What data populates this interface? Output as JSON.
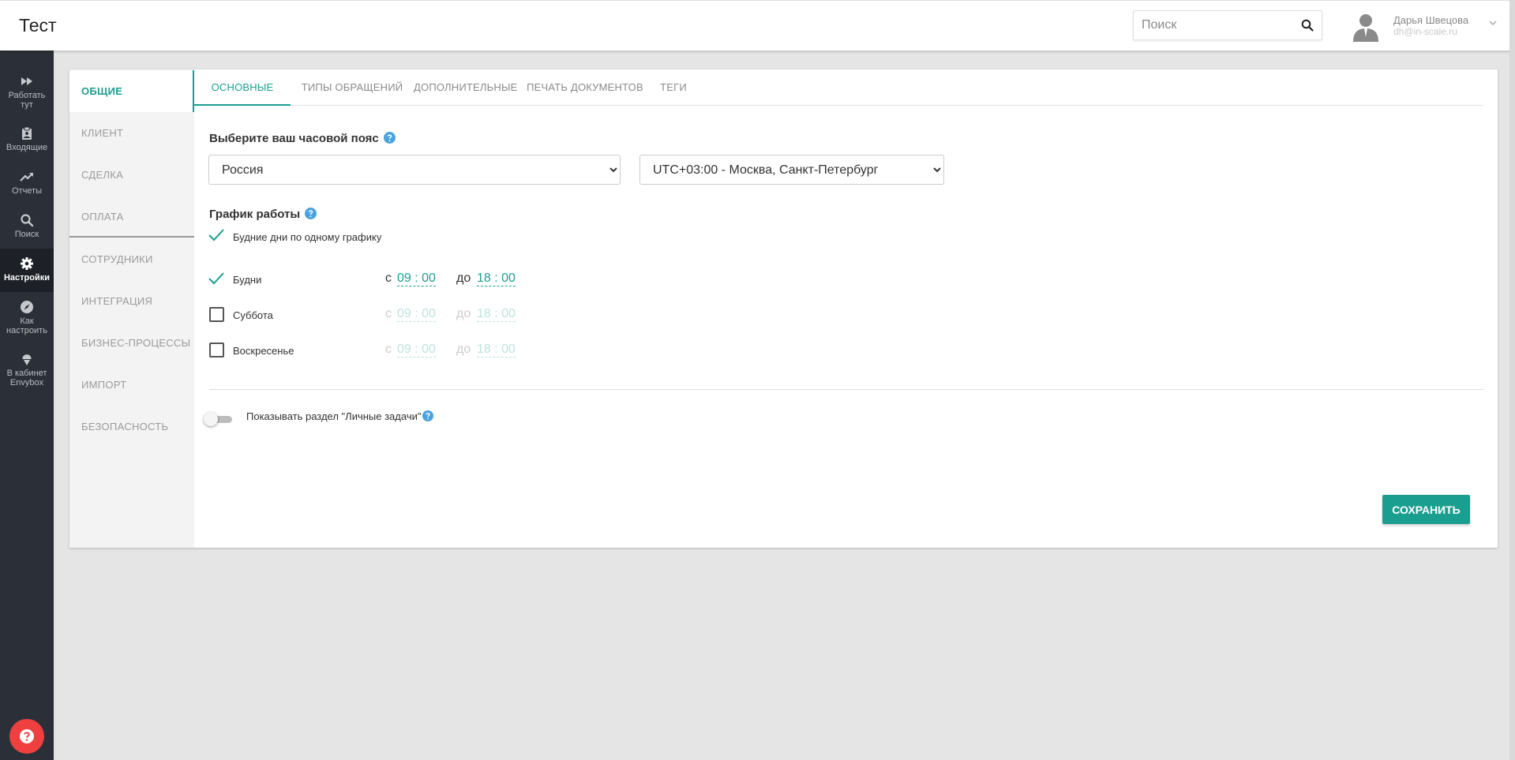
{
  "app": {
    "title": "Тест"
  },
  "header": {
    "search_placeholder": "Поиск",
    "user_name": "Дарья Швецова",
    "user_email": "dh@in-scale.ru"
  },
  "sidebar": {
    "items": [
      {
        "label_line1": "Работать",
        "label_line2": "тут",
        "icon": "fast-forward-icon"
      },
      {
        "label_line1": "Входящие",
        "label_line2": "",
        "icon": "clipboard-icon"
      },
      {
        "label_line1": "Отчеты",
        "label_line2": "",
        "icon": "trending-up-icon"
      },
      {
        "label_line1": "Поиск",
        "label_line2": "",
        "icon": "search-icon"
      },
      {
        "label_line1": "Настройки",
        "label_line2": "",
        "icon": "gear-icon",
        "active": true
      },
      {
        "label_line1": "Как",
        "label_line2": "настроить",
        "icon": "compass-icon"
      },
      {
        "label_line1": "В кабинет",
        "label_line2": "Envybox",
        "icon": "ice-cream-icon"
      }
    ],
    "help_icon": "help-icon"
  },
  "settings_nav": {
    "items": [
      "ОБЩИЕ",
      "КЛИЕНТ",
      "СДЕЛКА",
      "ОПЛАТА",
      "СОТРУДНИКИ",
      "ИНТЕГРАЦИЯ",
      "БИЗНЕС-ПРОЦЕССЫ",
      "ИМПОРТ",
      "БЕЗОПАСНОСТЬ"
    ],
    "active": "ОБЩИЕ"
  },
  "tabs": {
    "items": [
      "ОСНОВНЫЕ",
      "ТИПЫ ОБРАЩЕНИЙ",
      "ДОПОЛНИТЕЛЬНЫЕ",
      "ПЕЧАТЬ ДОКУМЕНТОВ",
      "ТЕГИ"
    ],
    "active": "ОСНОВНЫЕ"
  },
  "timezone": {
    "label": "Выберите ваш часовой пояс",
    "country": "Россия",
    "zone": "UTC+03:00 - Москва, Санкт-Петербург"
  },
  "schedule": {
    "label": "График работы",
    "same_schedule_label": "Будние дни по одному графику",
    "same_schedule_checked": true,
    "from_label": "с",
    "to_label": "до",
    "rows": [
      {
        "day": "Будни",
        "checked": true,
        "from": "09 : 00",
        "to": "18 : 00"
      },
      {
        "day": "Суббота",
        "checked": false,
        "from": "09 : 00",
        "to": "18 : 00"
      },
      {
        "day": "Воскресенье",
        "checked": false,
        "from": "09 : 00",
        "to": "18 : 00"
      }
    ]
  },
  "personal_tasks": {
    "label": "Показывать раздел \"Личные задачи\"",
    "enabled": false
  },
  "actions": {
    "save_label": "СОХРАНИТЬ"
  },
  "colors": {
    "accent": "#1a9e8f",
    "sidebar": "#2b3038",
    "help_fab": "#ef3f3f",
    "info": "#4aa3df"
  }
}
